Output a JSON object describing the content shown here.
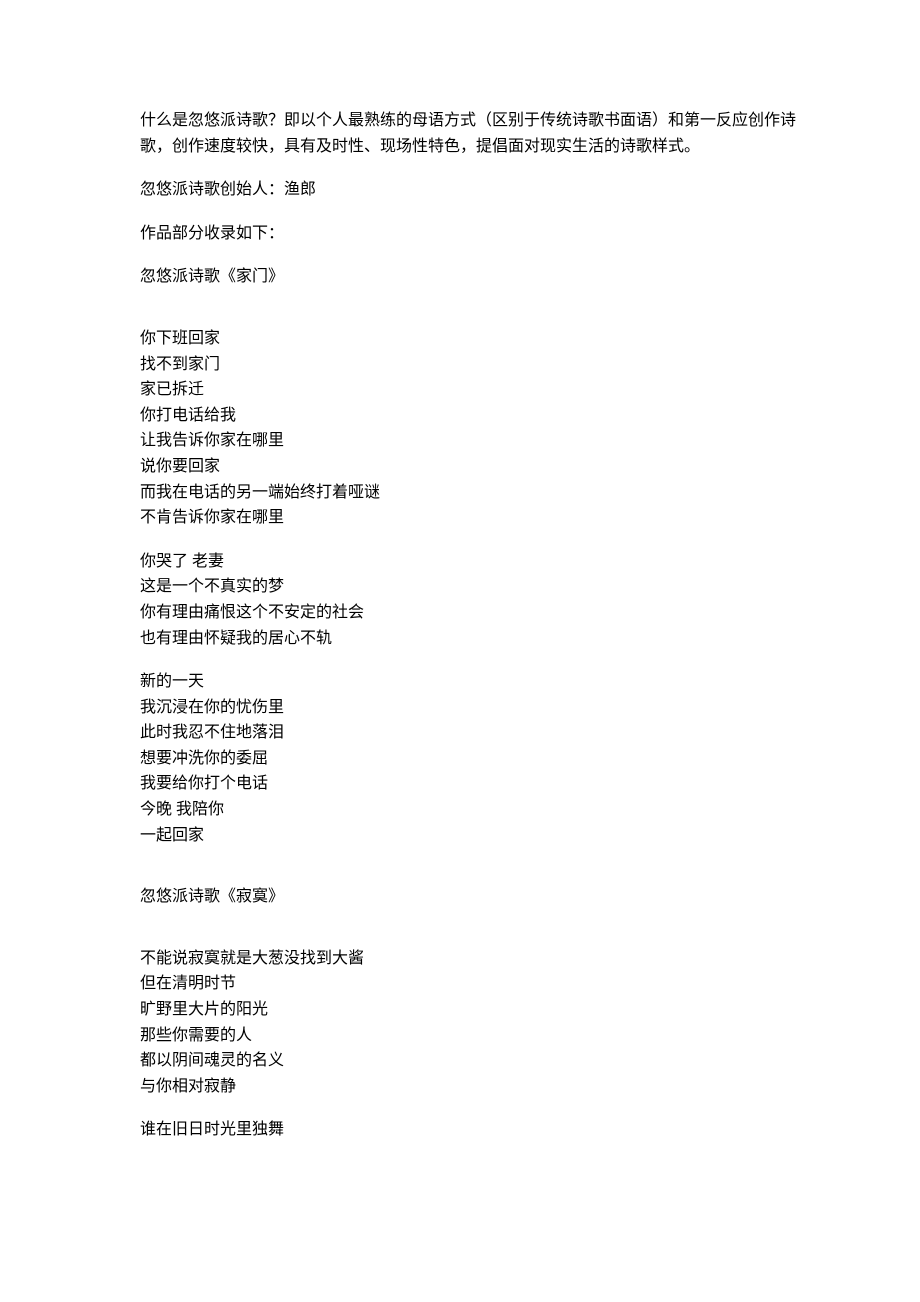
{
  "intro": "什么是忽悠派诗歌？即以个人最熟练的母语方式（区别于传统诗歌书面语）和第一反应创作诗歌，创作速度较快，具有及时性、现场性特色，提倡面对现实生活的诗歌样式。",
  "founder": "忽悠派诗歌创始人：渔郎",
  "collected_note": "作品部分收录如下：",
  "poems": [
    {
      "title": "忽悠派诗歌《家门》",
      "stanzas": [
        [
          "你下班回家",
          "找不到家门",
          "家已拆迁",
          "你打电话给我",
          "让我告诉你家在哪里",
          "说你要回家",
          "而我在电话的另一端始终打着哑谜",
          "不肯告诉你家在哪里"
        ],
        [
          "你哭了  老妻",
          "这是一个不真实的梦",
          "你有理由痛恨这个不安定的社会",
          "也有理由怀疑我的居心不轨"
        ],
        [
          "新的一天",
          "我沉浸在你的忧伤里",
          "此时我忍不住地落泪",
          "想要冲洗你的委屈",
          "我要给你打个电话",
          "今晚  我陪你",
          "一起回家"
        ]
      ]
    },
    {
      "title": "忽悠派诗歌《寂寞》",
      "stanzas": [
        [
          "不能说寂寞就是大葱没找到大酱",
          "但在清明时节",
          "旷野里大片的阳光",
          "那些你需要的人",
          "都以阴间魂灵的名义",
          "与你相对寂静"
        ],
        [
          "谁在旧日时光里独舞"
        ]
      ]
    }
  ]
}
